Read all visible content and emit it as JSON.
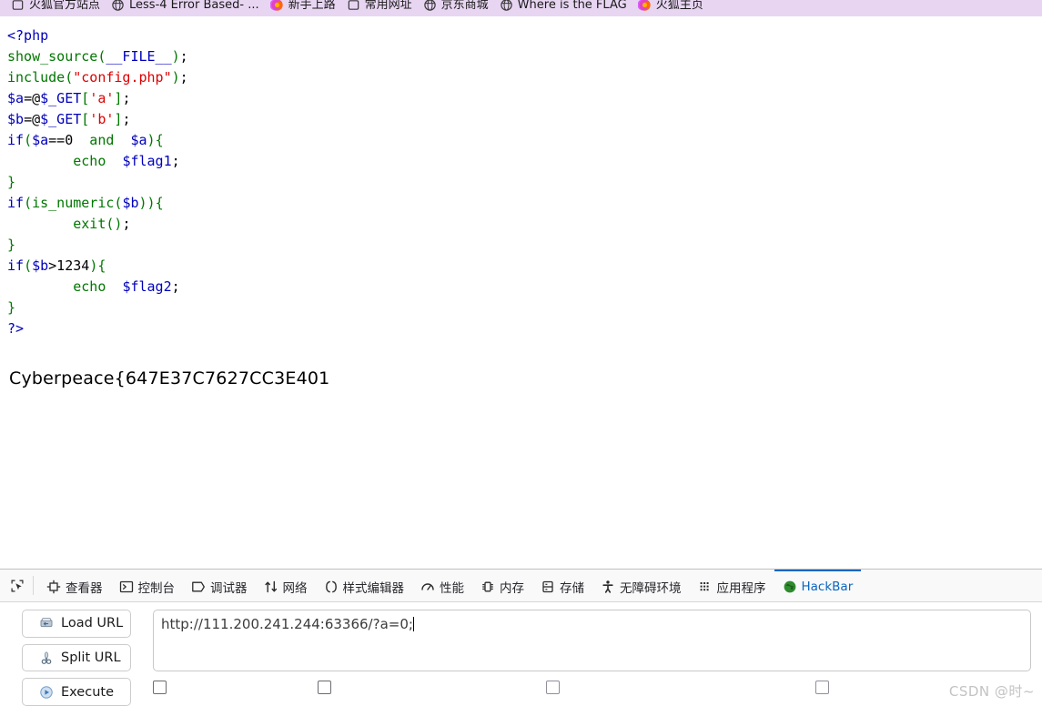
{
  "bookmarks": {
    "items": [
      {
        "label": "火狐官方站点",
        "icon": "bookmark-outline-icon"
      },
      {
        "label": "Less-4 Error Based- ...",
        "icon": "globe-icon"
      },
      {
        "label": "新手上路",
        "icon": "firefox-icon"
      },
      {
        "label": "常用网址",
        "icon": "bookmark-outline-icon"
      },
      {
        "label": "京东商城",
        "icon": "globe-icon"
      },
      {
        "label": "Where is the FLAG",
        "icon": "globe-icon"
      },
      {
        "label": "火狐主页",
        "icon": "firefox-icon"
      }
    ],
    "background_color": "#e8d5f2"
  },
  "page": {
    "code_lines": [
      [
        {
          "t": "<?php",
          "c": "blue"
        }
      ],
      [
        {
          "t": "show_source",
          "c": "green"
        },
        {
          "t": "(",
          "c": "green"
        },
        {
          "t": "__FILE__",
          "c": "blue"
        },
        {
          "t": ")",
          "c": "green"
        },
        {
          "t": ";",
          "c": "gray"
        }
      ],
      [
        {
          "t": "include",
          "c": "green"
        },
        {
          "t": "(",
          "c": "green"
        },
        {
          "t": "\"config.php\"",
          "c": "red"
        },
        {
          "t": ")",
          "c": "green"
        },
        {
          "t": ";",
          "c": "gray"
        }
      ],
      [
        {
          "t": "$a",
          "c": "blue"
        },
        {
          "t": "=@",
          "c": "gray"
        },
        {
          "t": "$_GET",
          "c": "blue"
        },
        {
          "t": "[",
          "c": "green"
        },
        {
          "t": "'a'",
          "c": "red"
        },
        {
          "t": "]",
          "c": "green"
        },
        {
          "t": ";",
          "c": "gray"
        }
      ],
      [
        {
          "t": "$b",
          "c": "blue"
        },
        {
          "t": "=@",
          "c": "gray"
        },
        {
          "t": "$_GET",
          "c": "blue"
        },
        {
          "t": "[",
          "c": "green"
        },
        {
          "t": "'b'",
          "c": "red"
        },
        {
          "t": "]",
          "c": "green"
        },
        {
          "t": ";",
          "c": "gray"
        }
      ],
      [
        {
          "t": "if",
          "c": "blue"
        },
        {
          "t": "(",
          "c": "green"
        },
        {
          "t": "$a",
          "c": "blue"
        },
        {
          "t": "==0",
          "c": "gray"
        },
        {
          "t": "  and  ",
          "c": "green"
        },
        {
          "t": "$a",
          "c": "blue"
        },
        {
          "t": ")",
          "c": "green"
        },
        {
          "t": "{",
          "c": "green"
        }
      ],
      [
        {
          "t": "        ",
          "c": "gray"
        },
        {
          "t": "echo",
          "c": "green"
        },
        {
          "t": "  ",
          "c": "gray"
        },
        {
          "t": "$flag1",
          "c": "blue"
        },
        {
          "t": ";",
          "c": "gray"
        }
      ],
      [
        {
          "t": "}",
          "c": "green"
        }
      ],
      [
        {
          "t": "if",
          "c": "blue"
        },
        {
          "t": "(",
          "c": "green"
        },
        {
          "t": "is_numeric",
          "c": "green"
        },
        {
          "t": "(",
          "c": "green"
        },
        {
          "t": "$b",
          "c": "blue"
        },
        {
          "t": ")",
          "c": "green"
        },
        {
          "t": ")",
          "c": "green"
        },
        {
          "t": "{",
          "c": "green"
        }
      ],
      [
        {
          "t": "        ",
          "c": "gray"
        },
        {
          "t": "exit",
          "c": "green"
        },
        {
          "t": "()",
          "c": "green"
        },
        {
          "t": ";",
          "c": "gray"
        }
      ],
      [
        {
          "t": "}",
          "c": "green"
        }
      ],
      [
        {
          "t": "if",
          "c": "blue"
        },
        {
          "t": "(",
          "c": "green"
        },
        {
          "t": "$b",
          "c": "blue"
        },
        {
          "t": ">1234",
          "c": "gray"
        },
        {
          "t": ")",
          "c": "green"
        },
        {
          "t": "{",
          "c": "green"
        }
      ],
      [
        {
          "t": "        ",
          "c": "gray"
        },
        {
          "t": "echo",
          "c": "green"
        },
        {
          "t": "  ",
          "c": "gray"
        },
        {
          "t": "$flag2",
          "c": "blue"
        },
        {
          "t": ";",
          "c": "gray"
        }
      ],
      [
        {
          "t": "}",
          "c": "green"
        }
      ],
      [
        {
          "t": "?>",
          "c": "blue"
        }
      ]
    ],
    "flag_output": "Cyberpeace{647E37C7627CC3E401"
  },
  "devtools": {
    "picker_icon": "element-picker-icon",
    "tabs": [
      {
        "label": "查看器",
        "icon": "inspector-icon",
        "active": false
      },
      {
        "label": "控制台",
        "icon": "console-icon",
        "active": false
      },
      {
        "label": "调试器",
        "icon": "debugger-icon",
        "active": false
      },
      {
        "label": "网络",
        "icon": "network-icon",
        "active": false
      },
      {
        "label": "样式编辑器",
        "icon": "style-editor-icon",
        "active": false
      },
      {
        "label": "性能",
        "icon": "performance-icon",
        "active": false
      },
      {
        "label": "内存",
        "icon": "memory-icon",
        "active": false
      },
      {
        "label": "存储",
        "icon": "storage-icon",
        "active": false
      },
      {
        "label": "无障碍环境",
        "icon": "accessibility-icon",
        "active": false
      },
      {
        "label": "应用程序",
        "icon": "application-icon",
        "active": false
      },
      {
        "label": "HackBar",
        "icon": "hackbar-icon",
        "active": true
      }
    ],
    "active_tab_color": "#0a66c2"
  },
  "hackbar": {
    "buttons": [
      {
        "label": "Load URL",
        "icon": "load-url-icon"
      },
      {
        "label": "Split URL",
        "icon": "split-url-icon"
      },
      {
        "label": "Execute",
        "icon": "execute-icon"
      }
    ],
    "url_value": "http://111.200.241.244:63366/?a=0;",
    "url_placeholder": "",
    "checkboxes": [
      {
        "label": "",
        "checked": false
      },
      {
        "label": "",
        "checked": false
      },
      {
        "label": "",
        "checked": false
      },
      {
        "label": "",
        "checked": false
      }
    ]
  },
  "watermark": {
    "text": "CSDN @时~"
  }
}
